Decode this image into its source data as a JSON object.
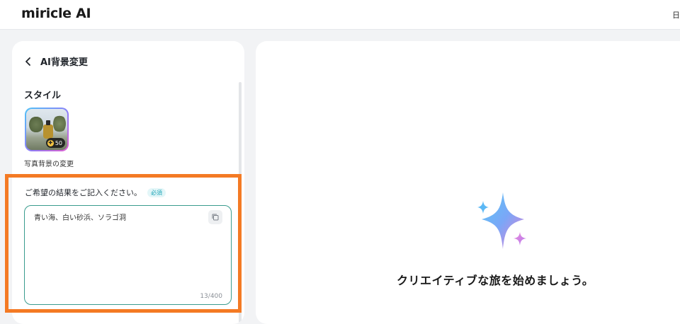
{
  "app": {
    "logo": "miricle AI",
    "header_right": "日"
  },
  "left_panel": {
    "title": "AI背景変更",
    "style_section_label": "スタイル",
    "style_item": {
      "caption": "写真背景の変更",
      "credit": "50"
    },
    "result_label": "ご希望の結果をご記入ください。",
    "required_badge": "必須",
    "prompt_value": "青い海、白い砂浜、ソラゴ洞",
    "char_count": "13/400"
  },
  "right_panel": {
    "empty_message": "クリエイティブな旅を始めましょう。"
  },
  "colors": {
    "highlight": "#f47a24",
    "accent": "#3a9c8e",
    "badge": "#1aa3b5"
  }
}
